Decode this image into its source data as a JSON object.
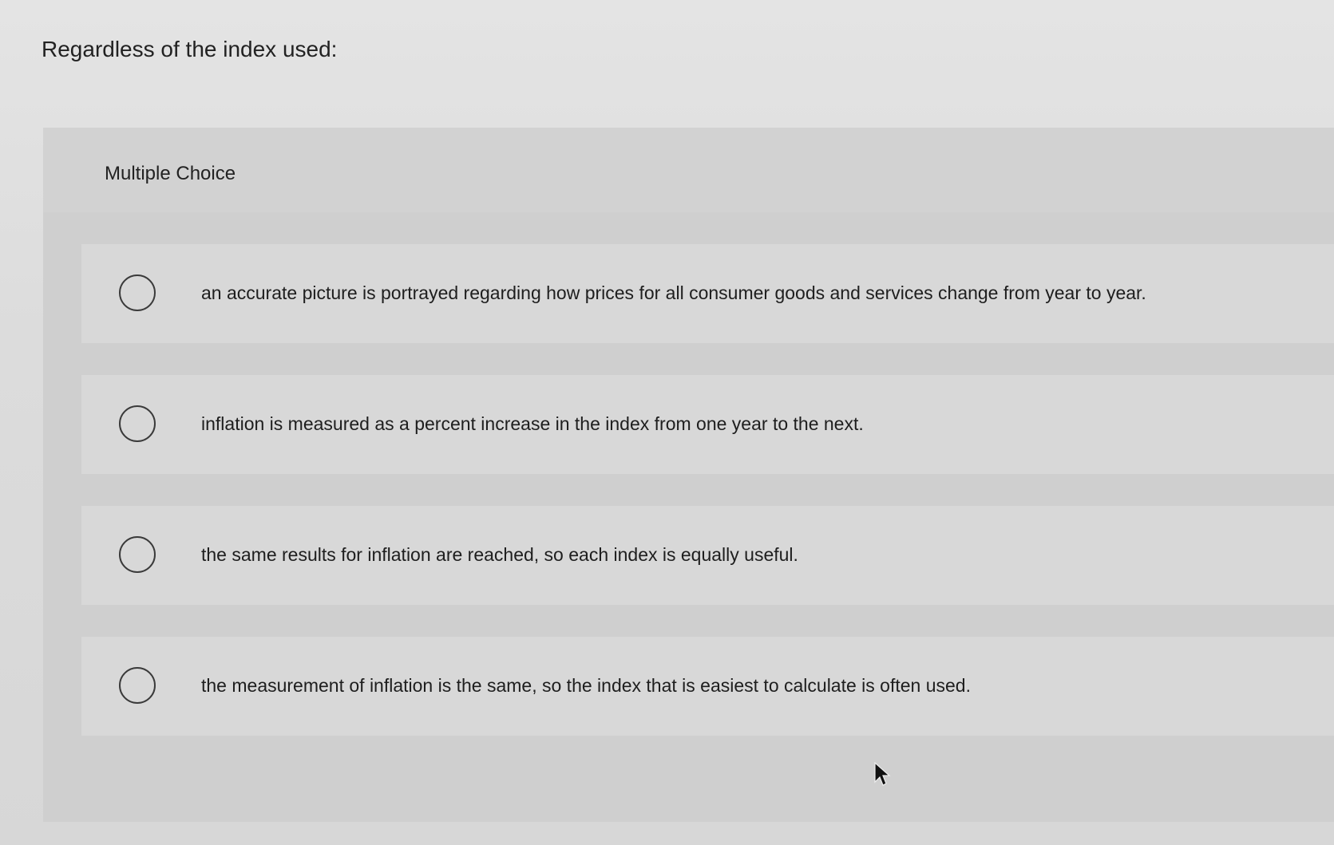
{
  "question": {
    "text": "Regardless of the index used:"
  },
  "mc": {
    "label": "Multiple Choice",
    "options": [
      {
        "label": "an accurate picture is portrayed regarding how prices for all consumer goods and services change from year to year."
      },
      {
        "label": "inflation is measured as a percent increase in the index from one year to the next."
      },
      {
        "label": "the same results for inflation are reached, so each index is equally useful."
      },
      {
        "label": "the measurement of inflation is the same, so the index that is easiest to calculate is often used."
      }
    ]
  },
  "icons": {
    "option_marker": "radio-button-icon",
    "pointer": "mouse-cursor-icon"
  }
}
